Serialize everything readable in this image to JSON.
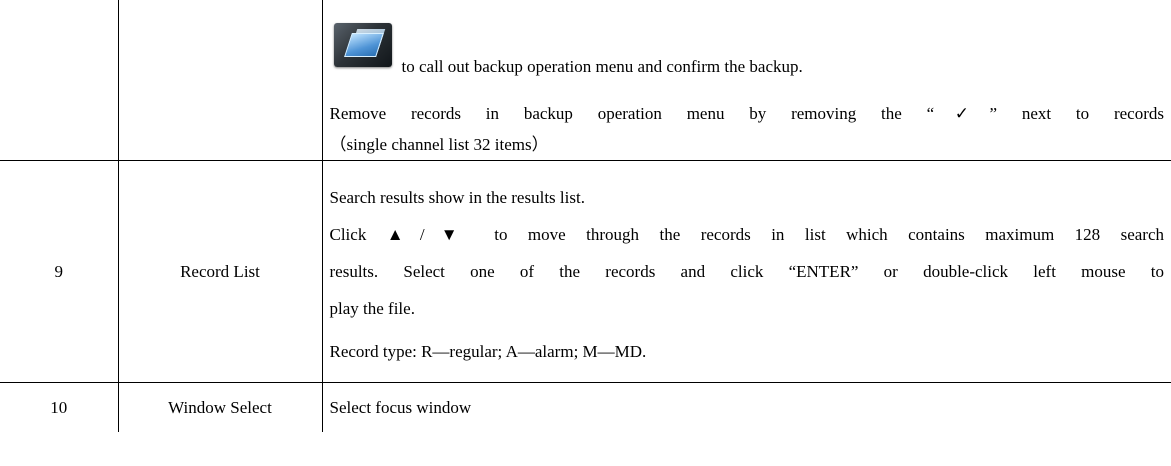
{
  "rows": [
    {
      "number": "",
      "name": "",
      "icon": "backup-folder-icon",
      "lines": [
        "to call out backup operation menu and confirm the backup.",
        "Remove records in backup operation menu by removing the “✓” next to records",
        "（single channel list 32 items）"
      ]
    },
    {
      "number": "9",
      "name": "Record List",
      "lines": [
        "Search results show in the results list.",
        "Click ▲/▼ to move through the records in list which contains maximum 128 search",
        "results. Select one of the records and click “ENTER” or double-click left mouse to",
        "play the file.",
        "Record type: R—regular; A—alarm; M—MD."
      ]
    },
    {
      "number": "10",
      "name": "Window Select",
      "lines": [
        "Select focus window"
      ]
    }
  ]
}
